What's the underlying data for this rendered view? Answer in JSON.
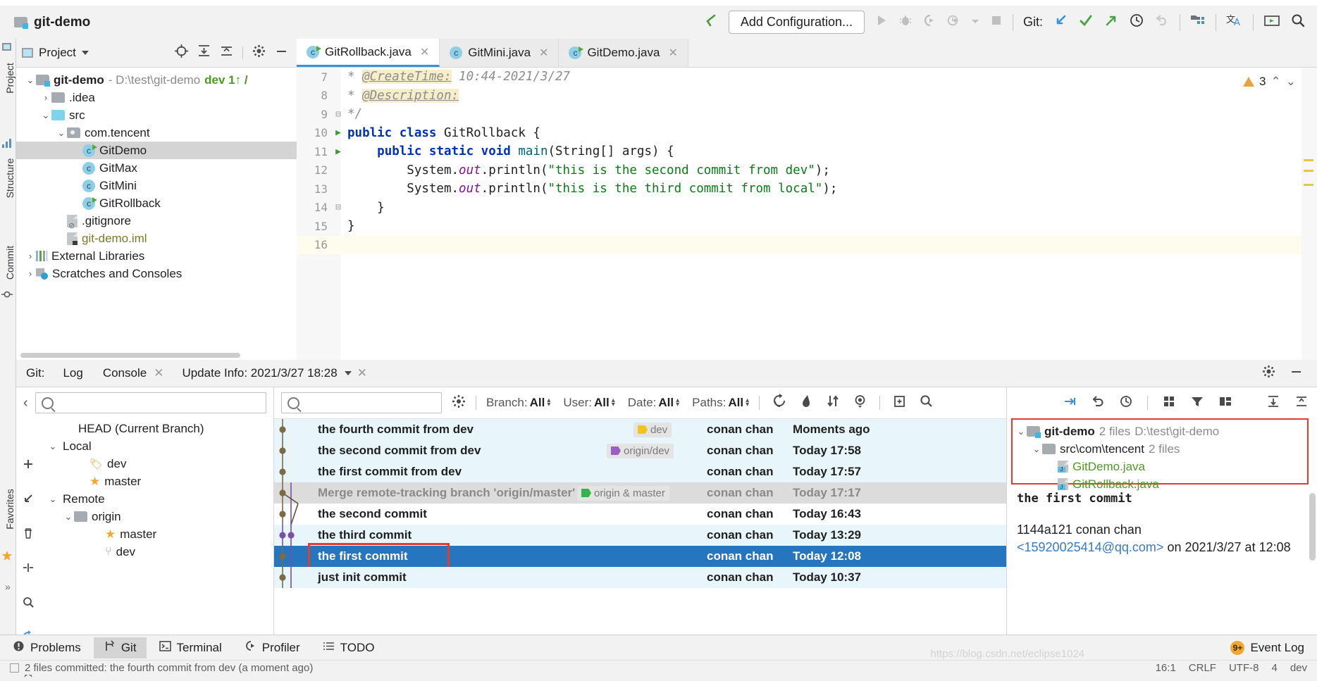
{
  "window": {
    "project_title": "git-demo"
  },
  "toolbar": {
    "add_configuration": "Add Configuration...",
    "git_label": "Git:",
    "icons": [
      "back-arrow-icon",
      "run-icon",
      "debug-icon",
      "run-coverage-icon",
      "profile-icon",
      "dropdown-icon",
      "stop-icon",
      "update-project-icon",
      "commit-icon",
      "push-icon",
      "history-icon",
      "rollback-icon",
      "project-structure-icon",
      "translate-icon",
      "presentation-icon",
      "search-everywhere-icon"
    ]
  },
  "rails": {
    "left": [
      "Project",
      "Structure",
      "Commit",
      "Favorites"
    ]
  },
  "project_panel": {
    "title": "Project",
    "header_icons": [
      "locate-icon",
      "expand-all-icon",
      "collapse-all-icon",
      "settings-icon",
      "hide-icon"
    ],
    "tree": [
      {
        "label": "git-demo",
        "suffix": "- D:\\test\\git-demo",
        "branch": "dev 1↑ /",
        "indent": 0,
        "arrow": "v",
        "icon": "module-folder-icon",
        "bold": true
      },
      {
        "label": ".idea",
        "indent": 1,
        "arrow": ">",
        "icon": "folder-icon"
      },
      {
        "label": "src",
        "indent": 1,
        "arrow": "v",
        "icon": "source-folder-icon"
      },
      {
        "label": "com.tencent",
        "indent": 2,
        "arrow": "v",
        "icon": "package-icon"
      },
      {
        "label": "GitDemo",
        "indent": 3,
        "arrow": "",
        "icon": "java-runnable-class-icon",
        "selected": true
      },
      {
        "label": "GitMax",
        "indent": 3,
        "arrow": "",
        "icon": "java-class-icon"
      },
      {
        "label": "GitMini",
        "indent": 3,
        "arrow": "",
        "icon": "java-class-icon"
      },
      {
        "label": "GitRollback",
        "indent": 3,
        "arrow": "",
        "icon": "java-runnable-class-icon"
      },
      {
        "label": ".gitignore",
        "indent": 2,
        "arrow": "",
        "icon": "gitignore-file-icon"
      },
      {
        "label": "git-demo.iml",
        "indent": 2,
        "arrow": "",
        "icon": "iml-file-icon",
        "olive": true
      },
      {
        "label": "External Libraries",
        "indent": 0,
        "arrow": ">",
        "icon": "libraries-icon"
      },
      {
        "label": "Scratches and Consoles",
        "indent": 0,
        "arrow": ">",
        "icon": "scratches-icon"
      }
    ]
  },
  "editor": {
    "tabs": [
      {
        "label": "GitRollback.java",
        "icon": "java-runnable-class-icon",
        "active": true
      },
      {
        "label": "GitMini.java",
        "icon": "java-class-icon",
        "active": false
      },
      {
        "label": "GitDemo.java",
        "icon": "java-runnable-class-icon",
        "active": false
      }
    ],
    "warning_count": "3",
    "lines": [
      {
        "num": "7",
        "gutter": "",
        "html": "star-createtime"
      },
      {
        "num": "8",
        "gutter": "",
        "html": "star-description"
      },
      {
        "num": "9",
        "gutter": "fold",
        "html": "comment-end"
      },
      {
        "num": "10",
        "gutter": "run",
        "html": "class-decl"
      },
      {
        "num": "11",
        "gutter": "run",
        "html": "main-decl"
      },
      {
        "num": "12",
        "gutter": "",
        "html": "println-second"
      },
      {
        "num": "13",
        "gutter": "",
        "html": "println-third"
      },
      {
        "num": "14",
        "gutter": "fold",
        "html": "close-brace-inner"
      },
      {
        "num": "15",
        "gutter": "",
        "html": "close-brace-outer"
      },
      {
        "num": "16",
        "gutter": "",
        "html": "empty",
        "current": true
      }
    ],
    "code_text": {
      "createtime_tag": "@CreateTime:",
      "createtime_val": " 10:44-2021/3/27",
      "description_tag": "@Description:",
      "comment_end": "*/",
      "class_decl_kw": "public class ",
      "class_decl_name": "GitRollback {",
      "main_kw1": "public static void ",
      "main_name": "main",
      "main_args": "(String[] args) {",
      "println_prefix": "System.",
      "println_out": "out",
      "println_mid": ".println(",
      "println_second_str": "\"this is the second commit from dev\"",
      "println_third_str": "\"this is the third commit from local\"",
      "println_suffix": ");",
      "brace_inner": "}",
      "brace_outer": "}"
    }
  },
  "git_window": {
    "label": "Git:",
    "tabs": [
      {
        "label": "Log",
        "active": true,
        "closable": false
      },
      {
        "label": "Console",
        "active": false,
        "closable": true
      },
      {
        "label": "Update Info: 2021/3/27 18:28",
        "active": false,
        "closable": true,
        "dropdown": true
      }
    ],
    "header_icons": [
      "settings-icon",
      "hide-icon"
    ],
    "branch_panel": {
      "search_placeholder": "",
      "items": [
        {
          "label": "HEAD (Current Branch)",
          "indent": 1,
          "arrow": "",
          "icon": ""
        },
        {
          "label": "Local",
          "indent": 0,
          "arrow": "v",
          "icon": ""
        },
        {
          "label": "dev",
          "indent": 2,
          "arrow": "",
          "icon": "tag-icon"
        },
        {
          "label": "master",
          "indent": 2,
          "arrow": "",
          "icon": "star-icon"
        },
        {
          "label": "Remote",
          "indent": 0,
          "arrow": "v",
          "icon": ""
        },
        {
          "label": "origin",
          "indent": 1,
          "arrow": "v",
          "icon": "folder-icon"
        },
        {
          "label": "master",
          "indent": 3,
          "arrow": "",
          "icon": "star-icon"
        },
        {
          "label": "dev",
          "indent": 3,
          "arrow": "",
          "icon": "branch-icon"
        }
      ]
    },
    "filters": [
      {
        "name": "Branch",
        "value": "All"
      },
      {
        "name": "User",
        "value": "All"
      },
      {
        "name": "Date",
        "value": "All"
      },
      {
        "name": "Paths",
        "value": "All"
      }
    ],
    "toolbar_icons": [
      "refresh-icon",
      "highlight-my-commits-icon",
      "sort-icon",
      "eye-icon",
      "add-column-icon",
      "search-icon"
    ],
    "right_toolbar_icons": [
      "cherry-pick-icon",
      "revert-icon",
      "history-icon",
      "grid-icon",
      "filter-icon",
      "columns-icon",
      "expand-icon",
      "collapse-icon"
    ],
    "commits": [
      {
        "subject": "the fourth  commit from dev",
        "author": "conan chan",
        "date": "Moments ago",
        "chip": "dev",
        "chip_color": "#f0c419",
        "row_bg": "#e8f6fb"
      },
      {
        "subject": "the second  commit from dev",
        "author": "conan chan",
        "date": "Today 17:58",
        "chip": "origin/dev",
        "chip_color": "#9b5fc0",
        "row_bg": "#e8f6fb"
      },
      {
        "subject": "the first  commit from dev",
        "author": "conan chan",
        "date": "Today 17:57",
        "chip": "",
        "chip_color": "",
        "row_bg": "#e8f6fb"
      },
      {
        "subject": "Merge remote-tracking branch 'origin/master' into mast",
        "author": "conan chan",
        "date": "Today 17:17",
        "chip": "origin & master",
        "chip_color": "#34b34a",
        "row_bg": "#dcdcdc",
        "muted": true
      },
      {
        "subject": "the second commit",
        "author": "conan chan",
        "date": "Today 16:43",
        "chip": "",
        "chip_color": "",
        "row_bg": "#ffffff"
      },
      {
        "subject": "the third commit",
        "author": "conan chan",
        "date": "Today 13:29",
        "chip": "",
        "chip_color": "",
        "row_bg": "#e8f6fb"
      },
      {
        "subject": "the first commit",
        "author": "conan chan",
        "date": "Today 12:08",
        "chip": "",
        "chip_color": "",
        "row_bg": "#2675bf",
        "selected": true,
        "highlight_box": true
      },
      {
        "subject": "just init commit",
        "author": "conan chan",
        "date": "Today 10:37",
        "chip": "",
        "chip_color": "",
        "row_bg": "#e8f6fb"
      }
    ],
    "details": {
      "changed_files": [
        {
          "label": "git-demo",
          "count": "2 files",
          "path": "D:\\test\\git-demo",
          "indent": 0,
          "arrow": "v",
          "icon": "module-folder-icon"
        },
        {
          "label": "src\\com\\tencent",
          "count": "2 files",
          "path": "",
          "indent": 1,
          "arrow": "v",
          "icon": "folder-icon"
        },
        {
          "label": "GitDemo.java",
          "count": "",
          "path": "",
          "indent": 2,
          "arrow": "",
          "icon": "java-file-icon"
        },
        {
          "label": "GitRollback.java",
          "count": "",
          "path": "",
          "indent": 2,
          "arrow": "",
          "icon": "java-file-icon"
        }
      ],
      "commit_message": "the first commit",
      "hash_author": "1144a121 conan chan",
      "email": "<15920025414@qq.com>",
      "committed_on": " on 2021/3/27 at 12:08"
    }
  },
  "bottom_bar": {
    "items": [
      {
        "label": "Problems",
        "icon": "problems-icon",
        "active": false
      },
      {
        "label": "Git",
        "icon": "git-branch-icon",
        "active": true
      },
      {
        "label": "Terminal",
        "icon": "terminal-icon",
        "active": false
      },
      {
        "label": "Profiler",
        "icon": "profiler-icon",
        "active": false
      },
      {
        "label": "TODO",
        "icon": "todo-icon",
        "active": false
      }
    ],
    "event_log": "Event Log",
    "event_badge": "9+"
  },
  "status_bar": {
    "message": "2 files committed: the fourth  commit from dev (a moment ago)",
    "caret": "16:1",
    "line_sep": "CRLF",
    "encoding": "UTF-8",
    "indent": "4",
    "branch": "dev",
    "watermark": "https://blog.csdn.net/eclipse1024"
  },
  "colors": {
    "accent_blue": "#2675bf",
    "highlight_red": "#e33b2e",
    "row_alt": "#e8f6fb",
    "green": "#4e9a22"
  }
}
